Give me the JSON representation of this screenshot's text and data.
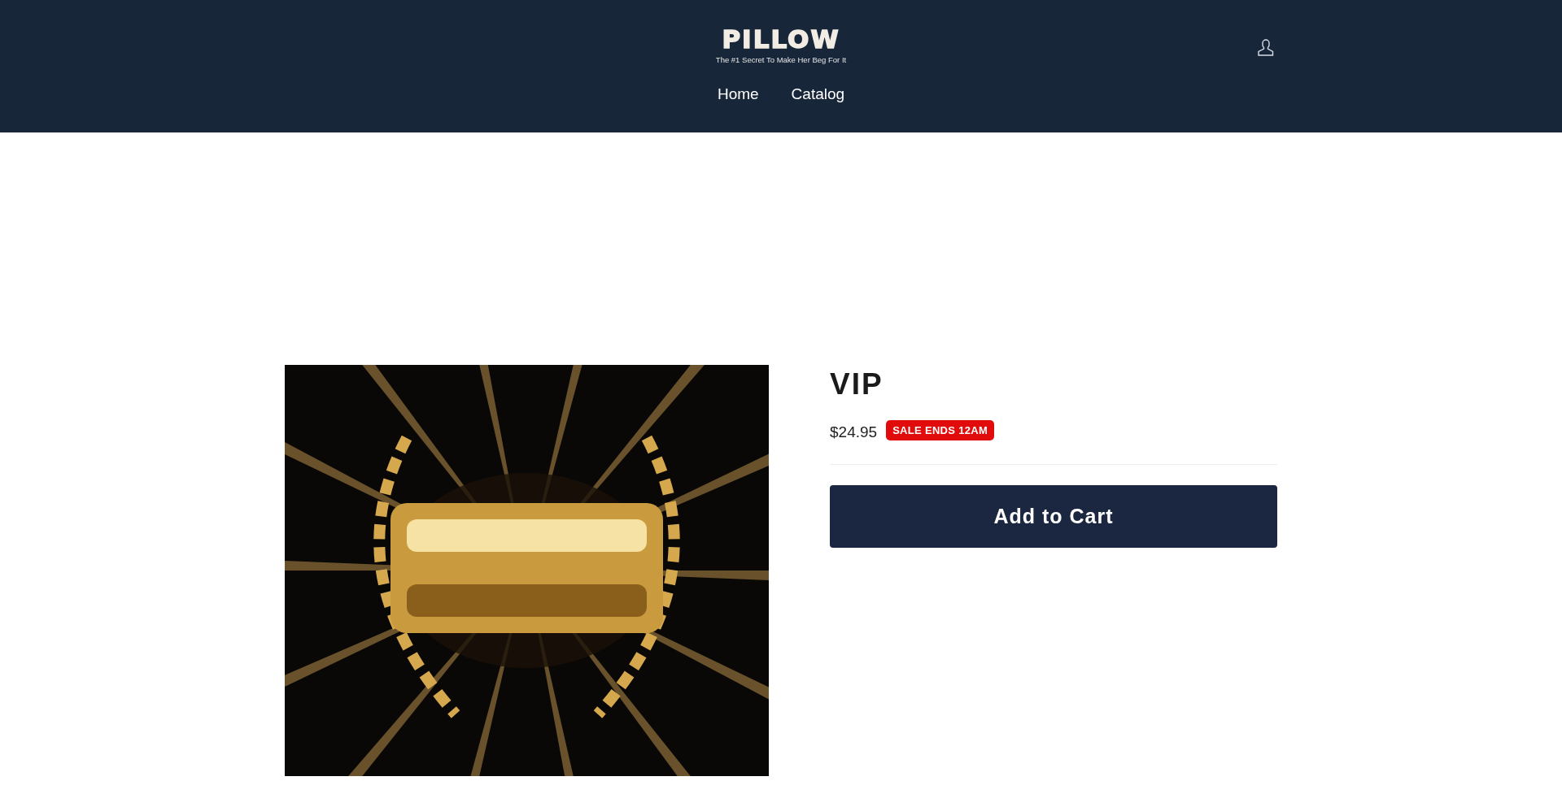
{
  "header": {
    "logo": "PILLOW",
    "tagline": "The #1 Secret To Make Her Beg For It",
    "nav": [
      {
        "label": "Home"
      },
      {
        "label": "Catalog"
      }
    ]
  },
  "product": {
    "title": "VIP",
    "price": "$24.95",
    "badge": "SALE ENDS 12AM",
    "button": "Add to Cart"
  }
}
